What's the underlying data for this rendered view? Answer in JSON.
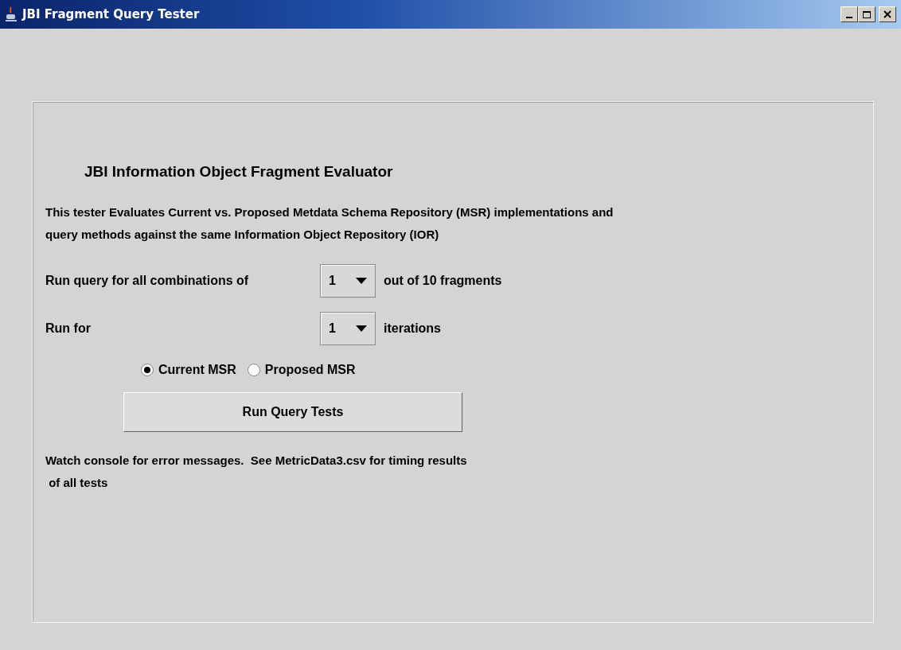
{
  "window": {
    "title": "JBI Fragment Query Tester"
  },
  "heading": "JBI Information Object Fragment Evaluator",
  "description": [
    "This tester Evaluates Current vs. Proposed Metdata Schema Repository (MSR) implementations and",
    "query methods against the same Information Object Repository (IOR)"
  ],
  "rows": [
    {
      "label": "Run query for all combinations of",
      "value": "1",
      "suffix": "out of 10 fragments"
    },
    {
      "label": "Run for",
      "value": "1",
      "suffix": "iterations"
    }
  ],
  "options": [
    {
      "label": "Current MSR",
      "selected": true
    },
    {
      "label": "Proposed MSR",
      "selected": false
    }
  ],
  "run_button": "Run Query Tests",
  "note": [
    "Watch console for error messages.  See MetricData3.csv for timing results",
    " of all tests"
  ]
}
